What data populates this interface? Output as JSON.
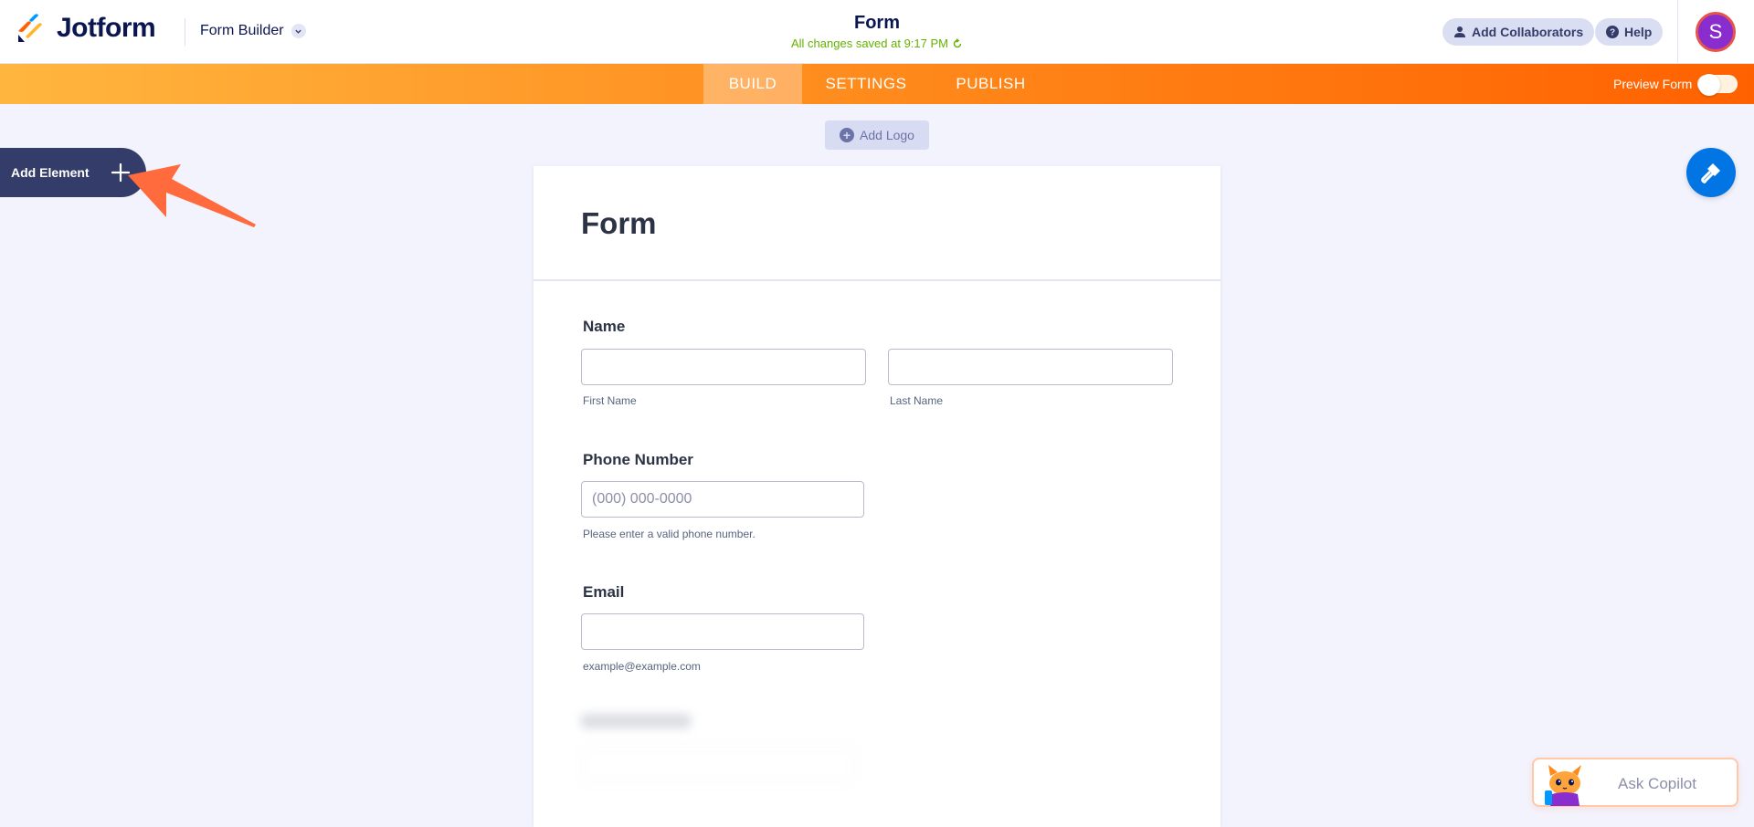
{
  "header": {
    "brand": "Jotform",
    "builder_menu": "Form Builder",
    "form_title": "Form",
    "save_status": "All changes saved at 9:17 PM",
    "add_collaborators": "Add Collaborators",
    "help": "Help",
    "avatar_initial": "S"
  },
  "nav": {
    "tabs": [
      {
        "label": "BUILD",
        "active": true
      },
      {
        "label": "SETTINGS",
        "active": false
      },
      {
        "label": "PUBLISH",
        "active": false
      }
    ],
    "preview_form": "Preview Form",
    "preview_enabled": false
  },
  "canvas": {
    "add_logo": "Add Logo",
    "add_element": "Add Element"
  },
  "form": {
    "title": "Form",
    "name": {
      "label": "Name",
      "first_sublabel": "First Name",
      "last_sublabel": "Last Name"
    },
    "phone": {
      "label": "Phone Number",
      "placeholder": "(000) 000-0000",
      "sublabel": "Please enter a valid phone number."
    },
    "email": {
      "label": "Email",
      "sublabel": "example@example.com"
    }
  },
  "copilot": {
    "label": "Ask Copilot"
  },
  "colors": {
    "brand_dark": "#0a1551",
    "nav_gradient_start": "#ffb63f",
    "nav_gradient_end": "#ff6100",
    "save_green": "#64b200",
    "paint_button": "#0075e3",
    "add_element_bg": "#343c6a",
    "arrow": "#ff6b3d"
  }
}
